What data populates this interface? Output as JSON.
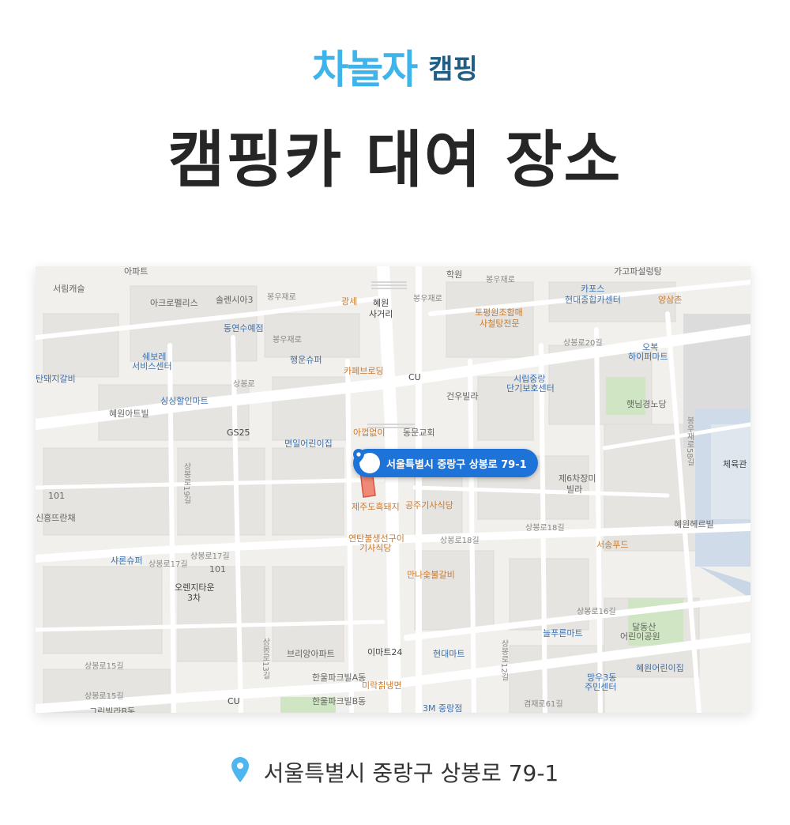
{
  "header": {
    "logo_main": "차놀자",
    "logo_sub": "캠핑",
    "title": "캠핑카 대여 장소"
  },
  "map": {
    "callout_text": "서울특별시 중랑구 상봉로 79-1",
    "pois": {
      "apt_top": "아파트",
      "seorim": "서림캐슬",
      "acropolis": "아크로펠리스",
      "solenasia": "솔렌시아3",
      "gwangse": "광세",
      "hyewon_1": "혜원",
      "hyewon_2": "사거리",
      "hakwon": "학원",
      "gagopa": "가고파설렁탕",
      "yangsamchon": "양삼촌",
      "capos_1": "카포스",
      "capos_2": "현대종합카센터",
      "dongyeon": "동연수예점",
      "tongpyeong_1": "토평원조함매",
      "tongpyeong_2": "사철탕전문",
      "chuibori_1": "쉐보레",
      "chuibori_2": "서비스센터",
      "haengun": "행운슈퍼",
      "cafe": "카페브로딩",
      "cu1": "CU",
      "city_1": "시립중랑",
      "city_2": "단기보호센터",
      "obuk_1": "오복",
      "obuk_2": "하이퍼마트",
      "tanpig": "탄돼지갈비",
      "simsim": "싱싱할인마트",
      "geonu": "건우빌라",
      "haesnim": "햇님경노당",
      "hyewon_art": "혜원아트빌",
      "gs25": "GS25",
      "myeonil": "면일어린이집",
      "agyeop": "아껍없이",
      "dongmun": "동문교회",
      "sports": "체육관",
      "jeju": "제주도흑돼지",
      "gongju": "공주기사식당",
      "sin6_1": "제6차장미",
      "sin6_2": "빌라",
      "sinheung": "신흥뜨란채",
      "hyewon_vil": "혜원헤르빌",
      "yeontan_1": "연탄불생선구이",
      "yeontan_2": "기사식당",
      "seosong": "서송푸드",
      "syaron": "샤론슈퍼",
      "orange_1": "오렌지타운",
      "orange_2": "3차",
      "manna": "만나숯불갈비",
      "dalsan_1": "달동산",
      "dalsan_2": "어린이공원",
      "neulpu": "늘푸른마트",
      "bright": "브리앙아파트",
      "emart": "이마트24",
      "hyundai": "현대마트",
      "hyewon_kids": "혜원어린이집",
      "mangu_1": "망우3동",
      "mangu_2": "주민센터",
      "hanul_a": "한울파크빌A동",
      "mirak": "미락칡냉면",
      "hanul_b": "한울파크빌B동",
      "cu2": "CU",
      "greenvil": "그린빌라B동",
      "3m": "3M 중랑점",
      "num_101a": "101",
      "num_101b": "101"
    },
    "roads": {
      "r1": "봉우재로",
      "r2": "봉우재로",
      "r3": "봉우재로",
      "r4": "봉우재로",
      "r5": "상봉로20길",
      "r6": "상봉로",
      "r7": "봉우재로58길",
      "r8": "상봉로18길",
      "r9": "상봉로17길",
      "r10": "상봉로17길",
      "r11": "상봉로16길",
      "r12": "상봉로15길",
      "r13": "상봉로15길",
      "r14": "겸재로61길",
      "r15": "상봉로19길",
      "r16": "상봉로18길",
      "r17": "상봉로13길",
      "r18": "상봉로12길"
    }
  },
  "address": {
    "text": "서울특별시 중랑구 상봉로 79-1",
    "pin_color": "#4eb6ef"
  }
}
